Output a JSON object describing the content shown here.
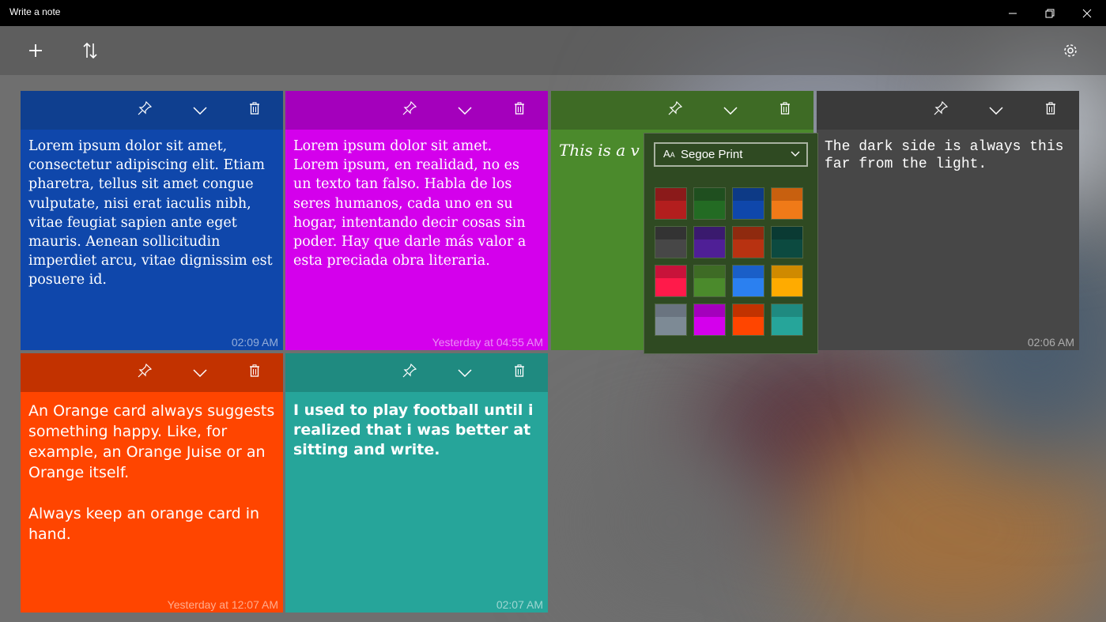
{
  "window": {
    "title": "Write a note",
    "minimize_icon": "minimize-icon",
    "maximize_icon": "restore-icon",
    "close_icon": "close-icon"
  },
  "toolbar": {
    "add_icon": "plus-icon",
    "sort_icon": "sort-arrows-icon",
    "settings_icon": "gear-icon"
  },
  "cards": [
    {
      "header_color": "#0f3f8f",
      "body_color": "#0f47ab",
      "text": "Lorem ipsum dolor sit amet, consectetur adipiscing elit. Etiam pharetra, tellus sit amet congue vulputate, nisi erat iaculis nibh, vitae feugiat sapien ante eget mauris. Aenean sollicitudin imperdiet arcu, vitae dignissim est posuere id.",
      "time": "02:09 AM",
      "font": "serif"
    },
    {
      "header_color": "#a400bc",
      "body_color": "#d400ec",
      "text": "Lorem ipsum dolor sit amet. Lorem ipsum, en realidad, no es un texto tan falso. Habla de los seres humanos, cada uno en su hogar, intentando decir cosas sin poder. Hay que darle más valor a esta preciada obra literaria.",
      "time": "Yesterday at 04:55 AM",
      "font": "serif"
    },
    {
      "header_color": "#3e6b25",
      "body_color": "#4b8a2c",
      "text": "This is a v",
      "time": "",
      "font": "print"
    },
    {
      "header_color": "#3a3a3a",
      "body_color": "#474747",
      "text": "The dark side is always this far from the light.",
      "time": "02:06 AM",
      "font": "mono"
    },
    {
      "header_color": "#c23200",
      "body_color": "#ff4500",
      "text": "An Orange card always suggests something happy. Like, for example, an Orange Juise or an Orange itself.\n\nAlways keep an orange card in hand.",
      "time": "Yesterday at 12:07 AM",
      "font": "sans"
    },
    {
      "header_color": "#1f8a80",
      "body_color": "#26a59a",
      "text": "I used to play football until i realized that i was better at sitting and write.",
      "time": "02:07 AM",
      "font": "sans-bold"
    }
  ],
  "card_icons": {
    "pin": "pin-icon",
    "expand": "chevron-down-icon",
    "delete": "trash-icon"
  },
  "popup": {
    "font_label": "Segoe Print",
    "font_icon": "font-icon",
    "dropdown_icon": "chevron-down-icon",
    "swatches": [
      {
        "top": "#8b1a1a",
        "bottom": "#b31e1e"
      },
      {
        "top": "#1f4f1f",
        "bottom": "#236b23"
      },
      {
        "top": "#0d3a86",
        "bottom": "#0f47ab"
      },
      {
        "top": "#c8600f",
        "bottom": "#f07a18"
      },
      {
        "top": "#333333",
        "bottom": "#474747"
      },
      {
        "top": "#3a1a6e",
        "bottom": "#4f1f96"
      },
      {
        "top": "#8f2a0f",
        "bottom": "#b83211"
      },
      {
        "top": "#0a3a33",
        "bottom": "#0c4a40"
      },
      {
        "top": "#c8133a",
        "bottom": "#ff1a4a"
      },
      {
        "top": "#3e6b25",
        "bottom": "#4b8a2c"
      },
      {
        "top": "#1a5fc8",
        "bottom": "#2b80f0"
      },
      {
        "top": "#cf8a00",
        "bottom": "#ffab00"
      },
      {
        "top": "#6a7480",
        "bottom": "#7d8a95"
      },
      {
        "top": "#a400bc",
        "bottom": "#d400ec"
      },
      {
        "top": "#c23200",
        "bottom": "#ff4500"
      },
      {
        "top": "#1f8a80",
        "bottom": "#26a59a"
      }
    ]
  }
}
